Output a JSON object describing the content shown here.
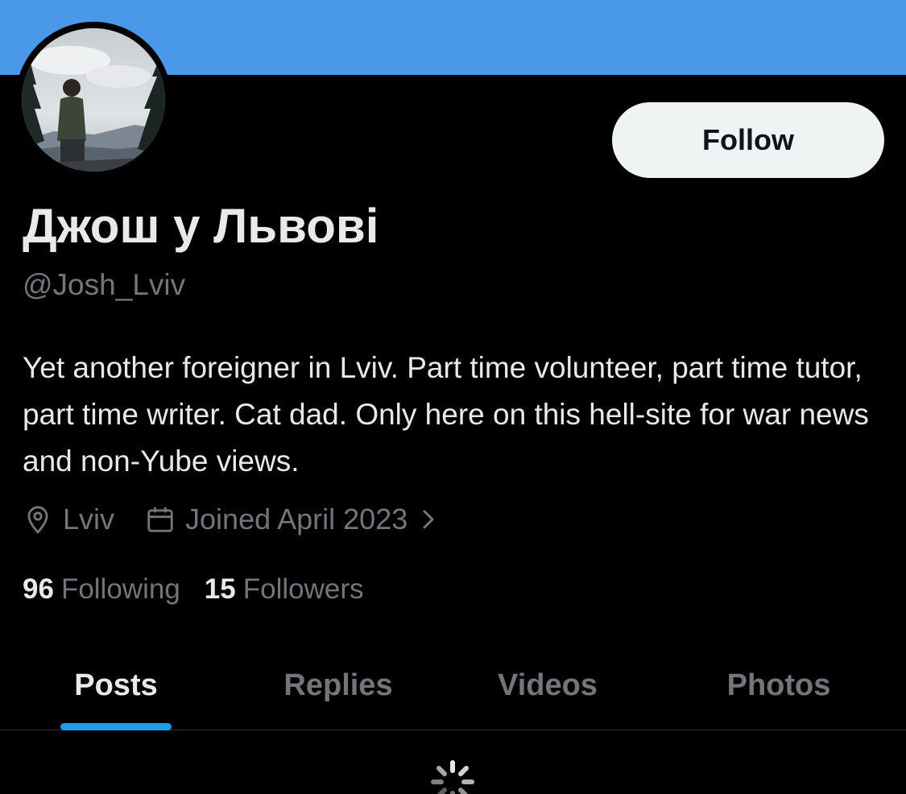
{
  "profile": {
    "display_name": "Джош у Львові",
    "handle": "@Josh_Lviv",
    "bio": "Yet another foreigner in Lviv. Part time volunteer, part time tutor, part time writer. Cat dad. Only here on this hell-site for war news and non-Yube views.",
    "location": "Lviv",
    "location_icon": "location-pin-icon",
    "joined": "Joined April 2023",
    "joined_icon": "calendar-icon",
    "following_count": "96",
    "following_label": "Following",
    "followers_count": "15",
    "followers_label": "Followers"
  },
  "actions": {
    "follow_label": "Follow"
  },
  "tabs": [
    {
      "label": "Posts",
      "active": true
    },
    {
      "label": "Replies",
      "active": false
    },
    {
      "label": "Videos",
      "active": false
    },
    {
      "label": "Photos",
      "active": false
    }
  ],
  "colors": {
    "banner": "#4a99e9",
    "accent": "#1d9bf0",
    "background": "#000000",
    "text_primary": "#e7e9ea",
    "text_secondary": "#71767b",
    "follow_button_bg": "#eff3f4"
  },
  "status": {
    "loading_icon": "loading-spinner-icon"
  }
}
